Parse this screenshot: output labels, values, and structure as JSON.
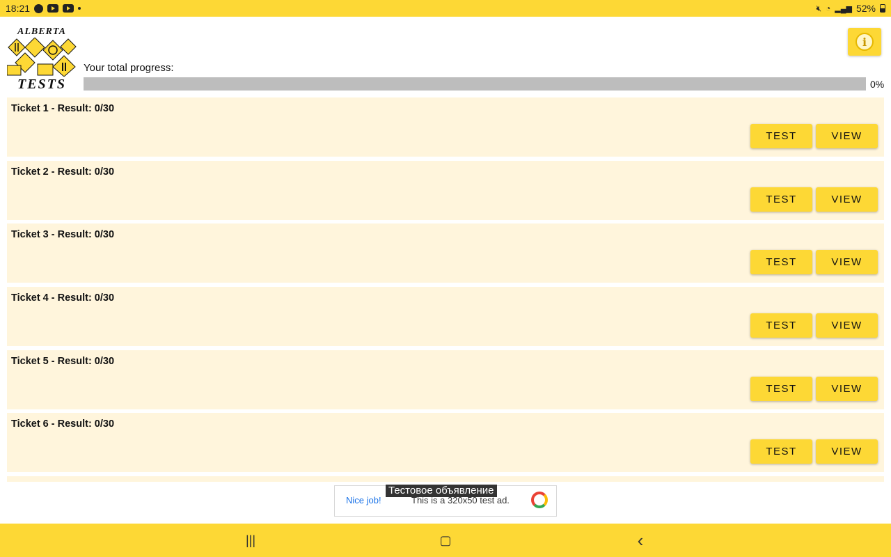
{
  "status_bar": {
    "time": "18:21",
    "battery": "52%"
  },
  "header": {
    "logo_top": "ALBERTA",
    "logo_bottom": "TESTS",
    "progress_label": "Your total progress:",
    "progress_value": 0,
    "progress_text": "0%"
  },
  "tickets": [
    {
      "title": "Ticket 1 - Result: 0/30",
      "test_label": "TEST",
      "view_label": "VIEW"
    },
    {
      "title": "Ticket 2 - Result: 0/30",
      "test_label": "TEST",
      "view_label": "VIEW"
    },
    {
      "title": "Ticket 3 - Result: 0/30",
      "test_label": "TEST",
      "view_label": "VIEW"
    },
    {
      "title": "Ticket 4 - Result: 0/30",
      "test_label": "TEST",
      "view_label": "VIEW"
    },
    {
      "title": "Ticket 5 - Result: 0/30",
      "test_label": "TEST",
      "view_label": "VIEW"
    },
    {
      "title": "Ticket 6 - Result: 0/30",
      "test_label": "TEST",
      "view_label": "VIEW"
    }
  ],
  "ad": {
    "label": "Тестовое объявление",
    "nice": "Nice job!",
    "description": "This is a 320x50 test ad."
  },
  "nav": {
    "recents": "|||",
    "home": "▢",
    "back": "‹"
  },
  "colors": {
    "accent": "#fdd835",
    "card_bg": "#fff5dc",
    "track": "#bdbdbd"
  }
}
